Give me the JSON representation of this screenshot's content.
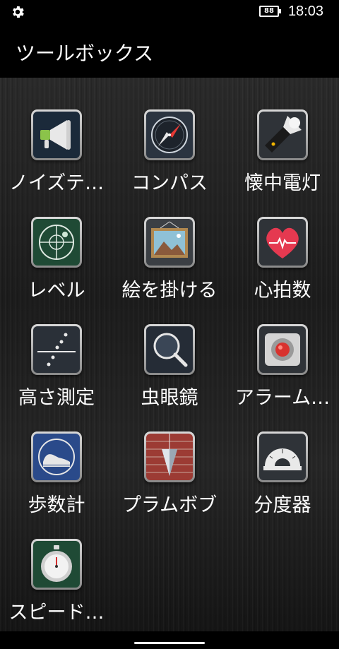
{
  "status_bar": {
    "battery_level": "88",
    "time": "18:03",
    "settings_icon": "gear-icon"
  },
  "app": {
    "title": "ツールボックス"
  },
  "tools": [
    {
      "label": "ノイズテ…",
      "icon": "megaphone-icon"
    },
    {
      "label": "コンパス",
      "icon": "compass-icon"
    },
    {
      "label": "懐中電灯",
      "icon": "flashlight-icon"
    },
    {
      "label": "レベル",
      "icon": "level-icon"
    },
    {
      "label": "絵を掛ける",
      "icon": "picture-frame-icon"
    },
    {
      "label": "心拍数",
      "icon": "heart-rate-icon"
    },
    {
      "label": "高さ測定",
      "icon": "height-measure-icon"
    },
    {
      "label": "虫眼鏡",
      "icon": "magnifier-icon"
    },
    {
      "label": "アラーム…",
      "icon": "alarm-icon"
    },
    {
      "label": "歩数計",
      "icon": "pedometer-icon"
    },
    {
      "label": "プラムボブ",
      "icon": "plumb-bob-icon"
    },
    {
      "label": "分度器",
      "icon": "protractor-icon"
    },
    {
      "label": "スピード…",
      "icon": "stopwatch-icon"
    }
  ]
}
